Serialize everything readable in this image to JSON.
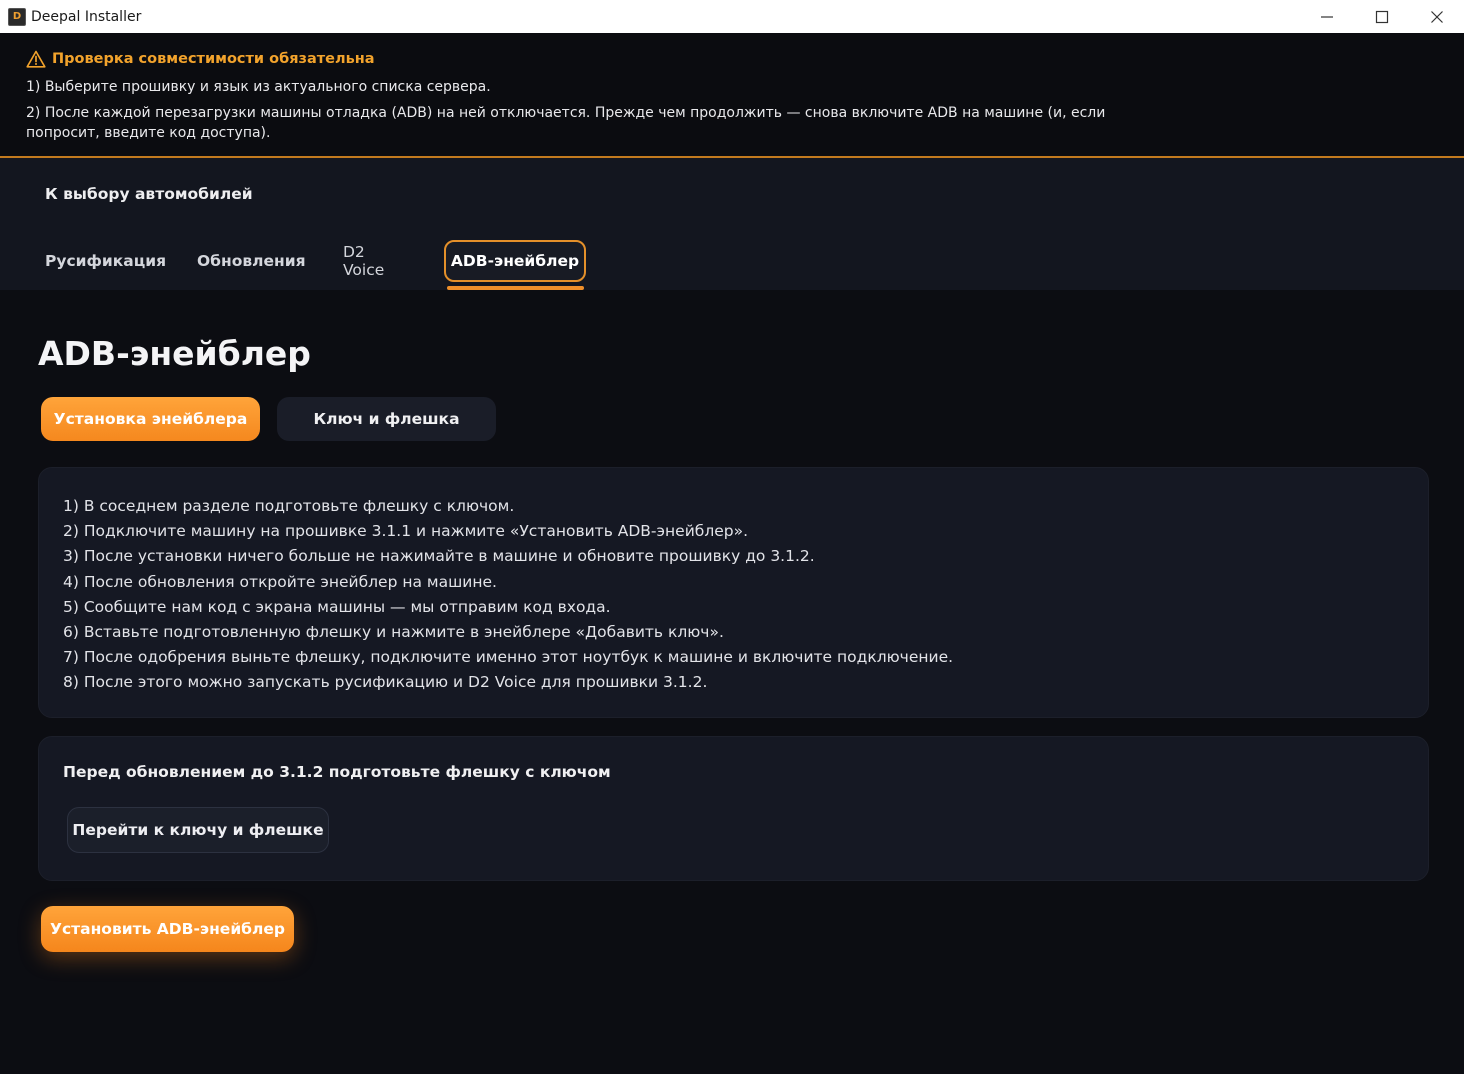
{
  "window": {
    "title": "Deepal Installer",
    "icon": "app-logo-icon",
    "controls": [
      "minimize-icon",
      "maximize-icon",
      "close-icon"
    ]
  },
  "banner": {
    "title": "Проверка совместимости обязательна",
    "icon": "warning-icon",
    "line1": "1) Выберите прошивку и язык из актуального списка сервера.",
    "line2": "2) После каждой перезагрузки машины отладка (ADB) на ней отключается. Прежде чем продолжить — снова включите ADB на машине (и, если попросит, введите код доступа).",
    "accent_color": "#f2a32c"
  },
  "header": {
    "back_label": "К выбору автомобилей",
    "tabs": [
      {
        "label": "Русификация"
      },
      {
        "label": "Обновления"
      },
      {
        "label": "D2 Voice"
      },
      {
        "label": "ADB-энейблер",
        "active": true
      }
    ]
  },
  "main": {
    "title": "ADB-энейблер",
    "subtabs": [
      {
        "label": "Установка энейблера",
        "active": true
      },
      {
        "label": "Ключ и флешка"
      }
    ],
    "steps": [
      "1) В соседнем разделе подготовьте флешку с ключом.",
      "2) Подключите машину на прошивке 3.1.1 и нажмите «Установить ADB-энейблер».",
      "3) После установки ничего больше не нажимайте в машине и обновите прошивку до 3.1.2.",
      "4) После обновления откройте энейблер на машине.",
      "5) Сообщите нам код с экрана машины — мы отправим код входа.",
      "6) Вставьте подготовленную флешку и нажмите в энейблере «Добавить ключ».",
      "7) После одобрения выньте флешку, подключите именно этот ноутбук к машине и включите подключение.",
      "8) После этого можно запускать русификацию и D2 Voice для прошивки 3.1.2."
    ],
    "prep": {
      "text": "Перед обновлением до 3.1.2 подготовьте флешку с ключом",
      "button_label": "Перейти к ключу и флешке"
    },
    "install_button_label": "Установить ADB-энейблер",
    "accent_color": "#f5881e"
  }
}
